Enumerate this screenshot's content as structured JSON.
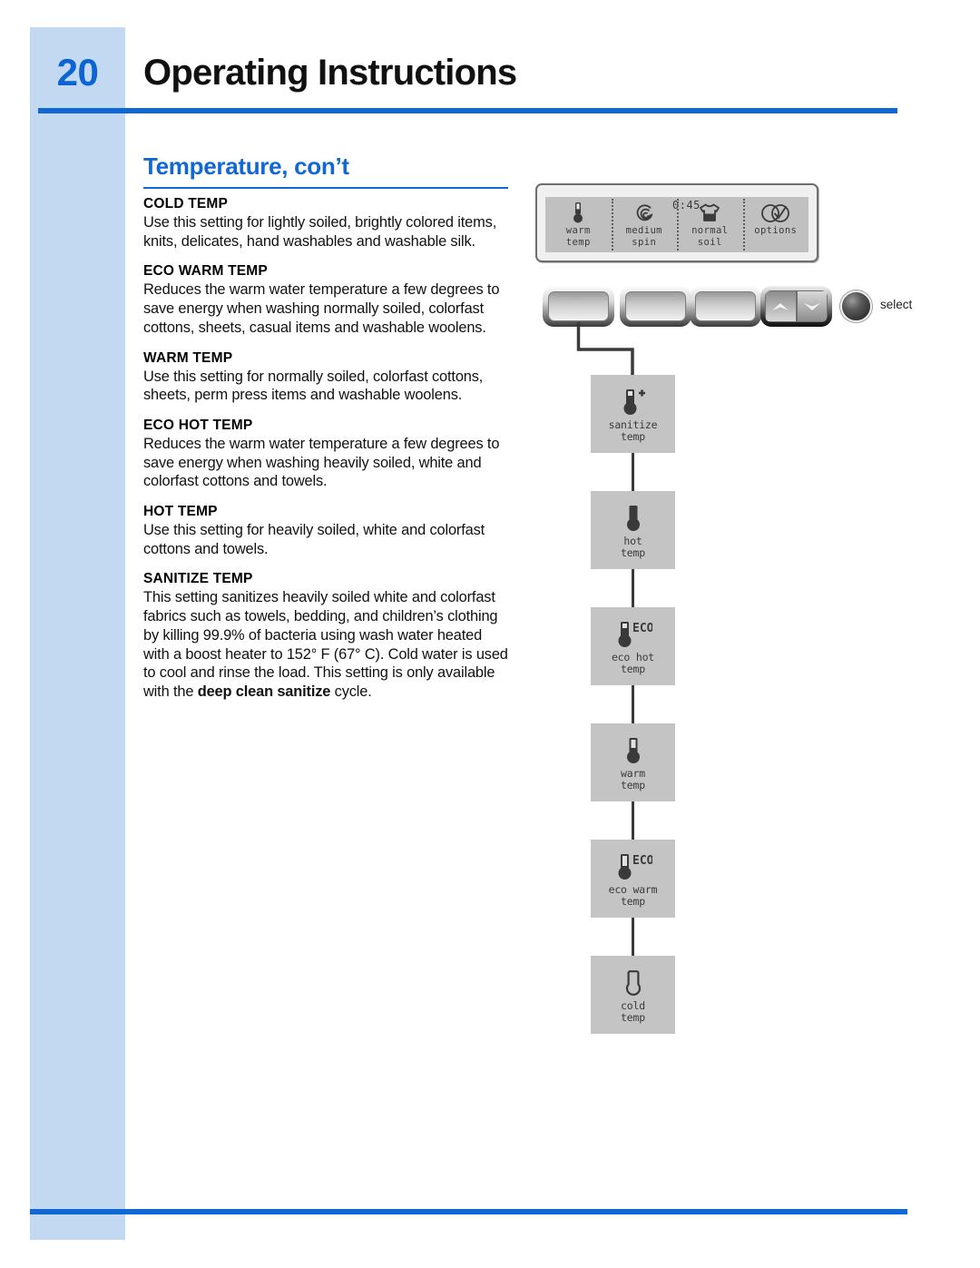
{
  "page": {
    "number": "20",
    "title": "Operating Instructions",
    "section_heading": "Temperature, con’t",
    "accent_color": "#1168d4",
    "sidebar_color": "#c3d9f2"
  },
  "sections": [
    {
      "title": "COLD TEMP",
      "body": "Use this setting for lightly soiled, brightly colored items, knits, delicates, hand washables and washable silk."
    },
    {
      "title": "ECO WARM TEMP",
      "body": "Reduces the warm water temperature a few degrees to save energy when washing normally soiled, colorfast cottons, sheets, casual items and washable woolens."
    },
    {
      "title": "WARM TEMP",
      "body": "Use this setting for normally soiled, colorfast cottons, sheets, perm press items and washable woolens."
    },
    {
      "title": "ECO HOT TEMP",
      "body": "Reduces the warm water temperature a few degrees to save energy when washing heavily soiled, white and colorfast cottons and towels."
    },
    {
      "title": "HOT TEMP",
      "body": "Use this setting for heavily soiled, white and colorfast cottons and towels."
    },
    {
      "title": "SANITIZE TEMP",
      "body_part1": "This setting sanitizes heavily soiled white and colorfast fabrics such as towels, bedding, and children’s clothing by killing 99.9% of bacteria using wash water heated with a boost heater to 152° F (67° C). Cold water is used to cool and rinse the load. This setting is only available with the ",
      "body_bold": "deep clean sanitize",
      "body_part2": " cycle."
    }
  ],
  "control_panel": {
    "display": {
      "time": "0:45",
      "cells": [
        {
          "icon": "thermometer-icon",
          "label_line1": "warm",
          "label_line2": "temp"
        },
        {
          "icon": "spiral-spin-icon",
          "label_line1": "medium",
          "label_line2": "spin"
        },
        {
          "icon": "tshirt-soil-icon",
          "label_line1": "normal",
          "label_line2": "soil"
        },
        {
          "icon": "options-check-icon",
          "label_line1": "",
          "label_line2": "options"
        }
      ]
    },
    "buttons": [
      {
        "name": "temp-button",
        "label": ""
      },
      {
        "name": "spin-button",
        "label": ""
      },
      {
        "name": "soil-button",
        "label": ""
      },
      {
        "name": "arrow-button",
        "label": ""
      }
    ],
    "select_knob_label": "select"
  },
  "temperature_flow": [
    {
      "icon": "thermometer-plus-icon",
      "label_line1": "sanitize",
      "label_line2": "temp"
    },
    {
      "icon": "thermometer-full-icon",
      "label_line1": "hot",
      "label_line2": "temp"
    },
    {
      "icon": "thermometer-eco-hot-icon",
      "label_line1": "eco hot",
      "label_line2": "temp"
    },
    {
      "icon": "thermometer-half-icon",
      "label_line1": "warm",
      "label_line2": "temp"
    },
    {
      "icon": "thermometer-eco-warm-icon",
      "label_line1": "eco warm",
      "label_line2": "temp"
    },
    {
      "icon": "thermometer-empty-icon",
      "label_line1": "cold",
      "label_line2": "temp"
    }
  ]
}
